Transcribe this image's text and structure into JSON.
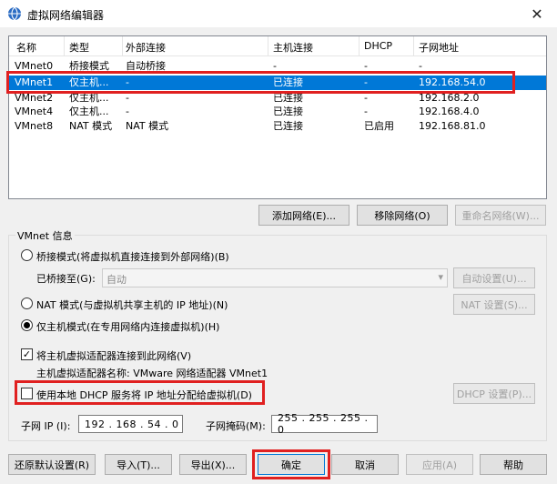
{
  "window": {
    "title": "虚拟网络编辑器",
    "close_glyph": "✕"
  },
  "network_list": {
    "columns": [
      "名称",
      "类型",
      "外部连接",
      "主机连接",
      "DHCP",
      "子网地址"
    ],
    "rows": [
      [
        "VMnet0",
        "桥接模式",
        "自动桥接",
        "-",
        "-",
        "-"
      ],
      [
        "VMnet1",
        "仅主机...",
        "-",
        "已连接",
        "-",
        "192.168.54.0"
      ],
      [
        "VMnet2",
        "仅主机...",
        "-",
        "已连接",
        "-",
        "192.168.2.0"
      ],
      [
        "VMnet4",
        "仅主机...",
        "-",
        "已连接",
        "-",
        "192.168.4.0"
      ],
      [
        "VMnet8",
        "NAT 模式",
        "NAT 模式",
        "已连接",
        "已启用",
        "192.168.81.0"
      ]
    ],
    "selected_index": 1
  },
  "list_buttons": {
    "add": "添加网络(E)...",
    "remove": "移除网络(O)",
    "rename": "重命名网络(W)..."
  },
  "vmnet_info": {
    "group_label": "VMnet 信息",
    "bridged_label": "桥接模式(将虚拟机直接连接到外部网络)(B)",
    "bridged_to_label": "已桥接至(G):",
    "bridged_to_value": "自动",
    "auto_settings": "自动设置(U)...",
    "nat_label": "NAT 模式(与虚拟机共享主机的 IP 地址)(N)",
    "nat_settings": "NAT 设置(S)...",
    "hostonly_label": "仅主机模式(在专用网络内连接虚拟机)(H)",
    "connect_adapter_label": "将主机虚拟适配器连接到此网络(V)",
    "adapter_name_label": "主机虚拟适配器名称: VMware 网络适配器 VMnet1",
    "dhcp_label": "使用本地 DHCP 服务将 IP 地址分配给虚拟机(D)",
    "dhcp_settings": "DHCP 设置(P)...",
    "subnet_ip_label": "子网 IP (I):",
    "subnet_ip_value": "192 . 168 . 54 . 0",
    "subnet_mask_label": "子网掩码(M):",
    "subnet_mask_value": "255 . 255 . 255 . 0",
    "selected_mode": "hostonly",
    "connect_adapter_checked": true,
    "dhcp_checked": false,
    "check_glyph": "✓"
  },
  "footer": {
    "restore": "还原默认设置(R)",
    "import": "导入(T)...",
    "export": "导出(X)...",
    "ok": "确定",
    "cancel": "取消",
    "apply": "应用(A)",
    "help": "帮助"
  },
  "colors": {
    "selection": "#0078d7",
    "highlight_box": "#e02020"
  }
}
